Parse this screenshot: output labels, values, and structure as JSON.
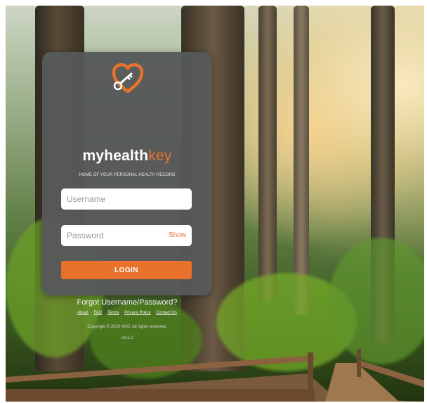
{
  "brand": {
    "name_main": "myhealth",
    "name_accent": "key",
    "tagline": "HOME OF YOUR PERSONAL HEALTH RECORD",
    "accent_color": "#e8722c"
  },
  "login_form": {
    "username_placeholder": "Username",
    "password_placeholder": "Password",
    "show_label": "Show",
    "login_label": "LOGIN"
  },
  "footer": {
    "forgot_label": "Forgot Username/Password?",
    "links": [
      "About",
      "FAQ",
      "Terms",
      "Privacy Policy",
      "Contact Us"
    ],
    "copyright": "Copyright © 2020 AHS. All rights reserved.",
    "version": "v4.1.2"
  },
  "icons": {
    "logo": "heart-key-icon"
  }
}
